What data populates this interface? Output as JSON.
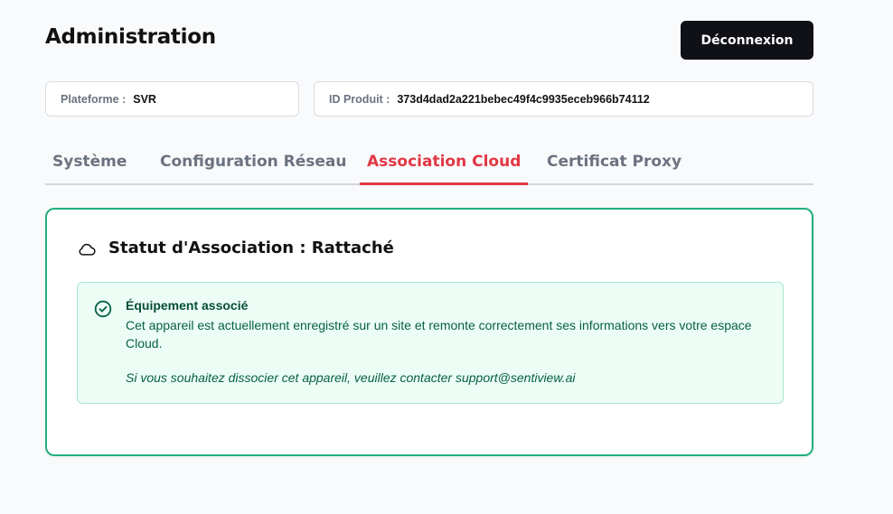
{
  "header": {
    "title": "Administration",
    "logout_label": "Déconnexion"
  },
  "info": {
    "platform_label": "Plateforme :",
    "platform_value": "SVR",
    "product_label": "ID Produit :",
    "product_value": "373d4dad2a221bebec49f4c9935eceb966b74112"
  },
  "tabs": [
    {
      "label": "Système",
      "active": false
    },
    {
      "label": "Configuration Réseau",
      "active": false
    },
    {
      "label": "Association Cloud",
      "active": true
    },
    {
      "label": "Certificat Proxy",
      "active": false
    }
  ],
  "card": {
    "icon": "cloud-icon",
    "title": "Statut d'Association : Rattaché",
    "alert": {
      "icon": "check-circle-icon",
      "title": "Équipement associé",
      "text": "Cet appareil est actuellement enregistré sur un site et remonte correctement ses informations vers votre espace Cloud.",
      "note": "Si vous souhaitez dissocier cet appareil, veuillez contacter support@sentiview.ai"
    }
  },
  "colors": {
    "accent_red": "#e23744",
    "success_green": "#22b07d",
    "dark_button": "#0f1117"
  }
}
